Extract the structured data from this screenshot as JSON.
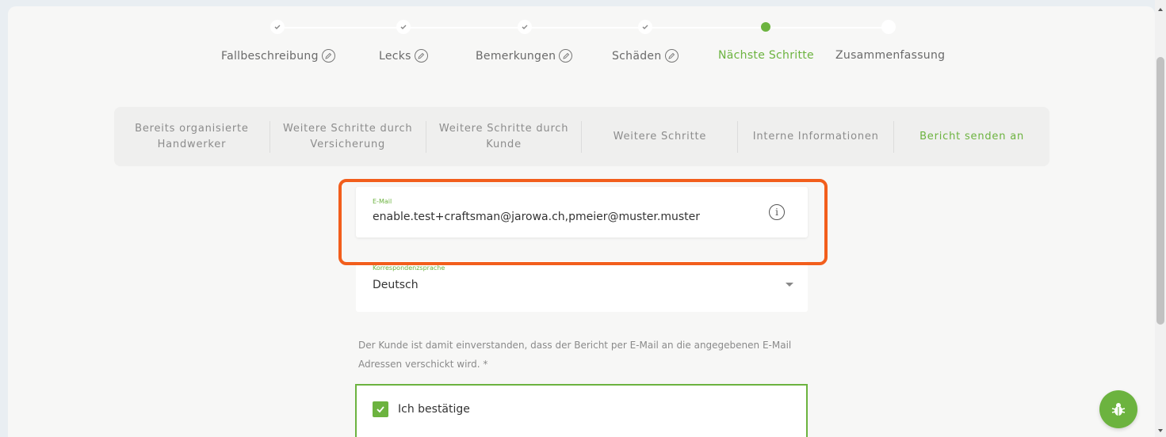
{
  "stepper": {
    "steps": [
      {
        "label": "Fallbeschreibung",
        "state": "done"
      },
      {
        "label": "Lecks",
        "state": "done"
      },
      {
        "label": "Bemerkungen",
        "state": "done"
      },
      {
        "label": "Schäden",
        "state": "done"
      },
      {
        "label": "Nächste Schritte",
        "state": "active"
      },
      {
        "label": "Zusammenfassung",
        "state": "todo"
      }
    ]
  },
  "subtabs": [
    {
      "label": "Bereits organisierte Handwerker"
    },
    {
      "label": "Weitere Schritte durch Versicherung"
    },
    {
      "label": "Weitere Schritte durch Kunde"
    },
    {
      "label": "Weitere Schritte"
    },
    {
      "label": "Interne Informationen"
    },
    {
      "label": "Bericht senden an"
    }
  ],
  "email_field": {
    "label": "E-Mail",
    "value": "enable.test+craftsman@jarowa.ch,pmeier@muster.muster",
    "info_glyph": "i"
  },
  "language_field": {
    "label": "Korrespondenzsprache",
    "value": "Deutsch"
  },
  "consent_text": "Der Kunde ist damit einverstanden, dass der Bericht per E-Mail an die angegebenen E-Mail Adressen verschickt wird. *",
  "confirm_label": "Ich bestätige",
  "colors": {
    "accent": "#6cb33f",
    "highlight": "#f25e1c"
  }
}
